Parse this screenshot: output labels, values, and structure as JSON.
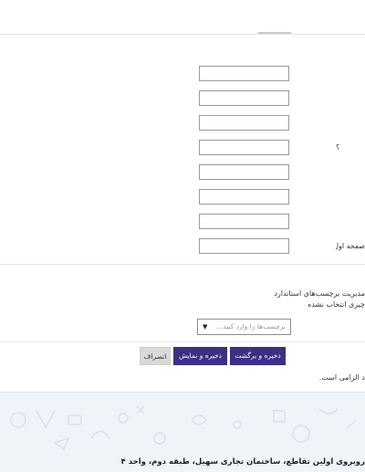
{
  "form": {
    "row_label_4": "؟",
    "row_label_8": "صفحه اول»",
    "standard_tags_title": "مدیریت برچسب‌های استاندارد",
    "nothing_selected": "چیزی انتخاب نشده",
    "tag_input_placeholder": "برچسب‌ها را وارد کنید...",
    "tag_dropdown_arrow": "▼"
  },
  "buttons": {
    "save_and_return": "ذخیره و برگشت",
    "save_and_display": "ذخیره و نمایش",
    "cancel": "انصراف"
  },
  "notes": {
    "required_fields": "د الزامی است."
  },
  "footer": {
    "address": "روبروی اولین تقاطع، ساختمان تجاری سهیل، طبقه دوم، واحد ۴"
  },
  "colors": {
    "primary_button": "#3d2f86",
    "footer_background": "#eef4f8"
  }
}
